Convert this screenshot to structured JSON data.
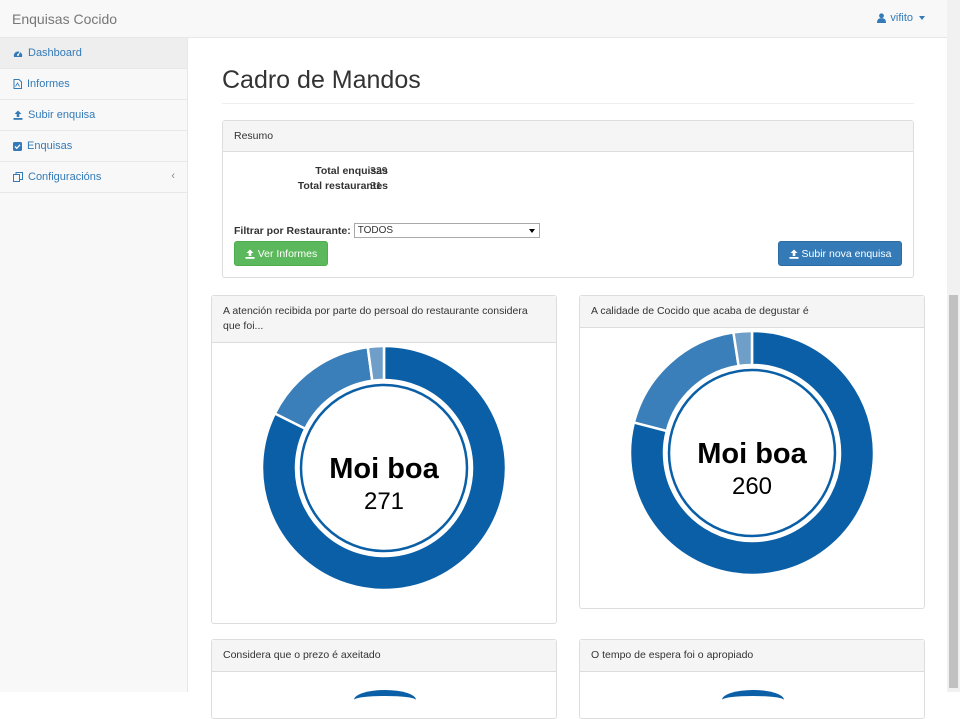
{
  "app": {
    "brand": "Enquisas Cocido",
    "user": "vifito"
  },
  "sidebar": {
    "items": [
      {
        "label": "Dashboard",
        "icon": "dashboard-icon",
        "active": true
      },
      {
        "label": "Informes",
        "icon": "file-pdf-icon"
      },
      {
        "label": "Subir enquisa",
        "icon": "upload-icon"
      },
      {
        "label": "Enquisas",
        "icon": "check-square-icon"
      },
      {
        "label": "Configuracións",
        "icon": "copy-icon",
        "arrow": "‹"
      }
    ]
  },
  "main": {
    "title": "Cadro de Mandos"
  },
  "summary": {
    "heading": "Resumo",
    "stats": [
      {
        "label": "Total enquisas",
        "value": "329"
      },
      {
        "label": "Total restaurantes",
        "value": "31"
      }
    ],
    "filter_label": "Filtrar por Restaurante:",
    "filter_value": "TODOS",
    "btn_reports": "Ver Informes",
    "btn_upload": "Subir nova enquisa"
  },
  "colors": {
    "primary_dark": "#0a5fa6",
    "primary_mid": "#3a7fb9",
    "primary_light": "#6f9fc9",
    "success": "#5cb85c",
    "primary": "#337ab7"
  },
  "charts": [
    {
      "question": "A atención recibida por parte do persoal do restaurante considera que foi...",
      "center_label": "Moi boa",
      "center_value": "271"
    },
    {
      "question": "A calidade de Cocido que acaba de degustar é",
      "center_label": "Moi boa",
      "center_value": "260"
    },
    {
      "question": "Considera que o prezo é axeitado"
    },
    {
      "question": "O tempo de espera foi o apropiado"
    }
  ],
  "chart_data": [
    {
      "type": "pie",
      "categories": [
        "Moi boa",
        "",
        ""
      ],
      "values": [
        271,
        51,
        7
      ]
    },
    {
      "type": "pie",
      "categories": [
        "Moi boa",
        "",
        ""
      ],
      "values": [
        260,
        61,
        8
      ]
    }
  ]
}
